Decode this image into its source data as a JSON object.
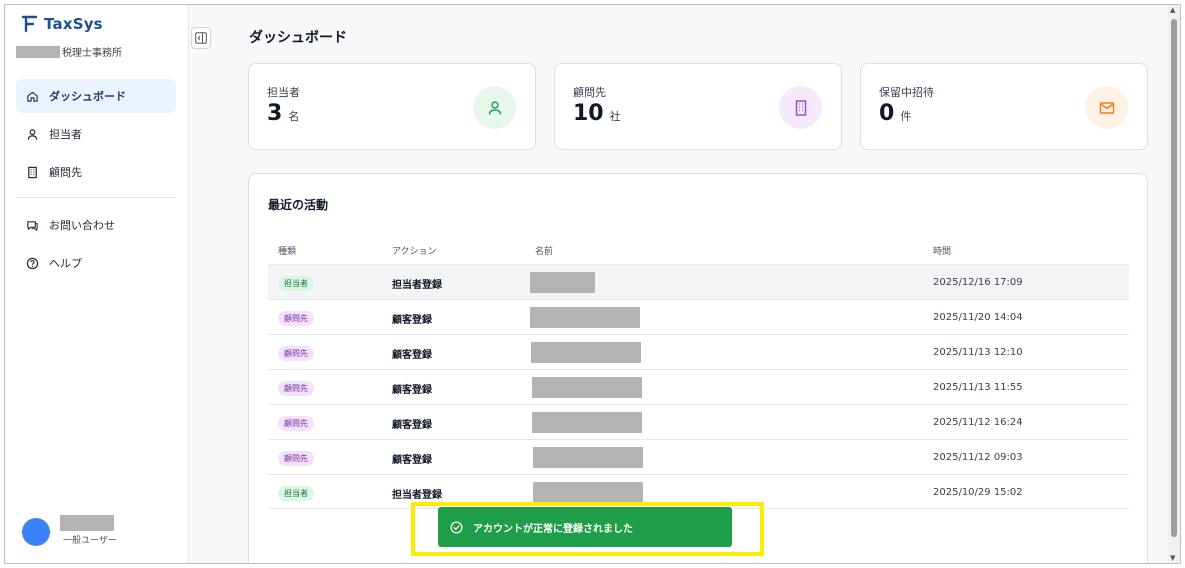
{
  "app": {
    "name": "TaxSys",
    "office_suffix": "税理士事務所",
    "accent": "#1e4f8f"
  },
  "sidebar": {
    "items": [
      {
        "label": "ダッシュボード",
        "icon": "home-icon",
        "active": true
      },
      {
        "label": "担当者",
        "icon": "user-icon",
        "active": false
      },
      {
        "label": "顧問先",
        "icon": "building-icon",
        "active": false
      }
    ],
    "secondary": [
      {
        "label": "お問い合わせ",
        "icon": "chat-icon"
      },
      {
        "label": "ヘルプ",
        "icon": "help-icon"
      }
    ],
    "user": {
      "role": "一般ユーザー"
    }
  },
  "page": {
    "title": "ダッシュボード"
  },
  "stats": [
    {
      "label": "担当者",
      "value": "3",
      "unit": "名",
      "icon": "user-icon",
      "color": "#22a35a",
      "bg": "#e7f7ec"
    },
    {
      "label": "顧問先",
      "value": "10",
      "unit": "社",
      "icon": "building-icon",
      "color": "#9b4fd0",
      "bg": "#f5eafc"
    },
    {
      "label": "保留中招待",
      "value": "0",
      "unit": "件",
      "icon": "mail-icon",
      "color": "#ef7d1a",
      "bg": "#fff1e3"
    }
  ],
  "activity": {
    "title": "最近の活動",
    "columns": [
      "種類",
      "アクション",
      "名前",
      "時間"
    ],
    "rows": [
      {
        "type": "担当者",
        "kind": "staff",
        "action": "担当者登録",
        "time": "2025/12/16 17:09"
      },
      {
        "type": "顧問先",
        "kind": "client",
        "action": "顧客登録",
        "time": "2025/11/20 14:04"
      },
      {
        "type": "顧問先",
        "kind": "client",
        "action": "顧客登録",
        "time": "2025/11/13 12:10"
      },
      {
        "type": "顧問先",
        "kind": "client",
        "action": "顧客登録",
        "time": "2025/11/13 11:55"
      },
      {
        "type": "顧問先",
        "kind": "client",
        "action": "顧客登録",
        "time": "2025/11/12 16:24"
      },
      {
        "type": "顧問先",
        "kind": "client",
        "action": "顧客登録",
        "time": "2025/11/12 09:03"
      },
      {
        "type": "担当者",
        "kind": "staff",
        "action": "担当者登録",
        "time": "2025/10/29 15:02"
      }
    ]
  },
  "toast": {
    "message": "アカウントが正常に登録されました",
    "color": "#1e9e48"
  }
}
